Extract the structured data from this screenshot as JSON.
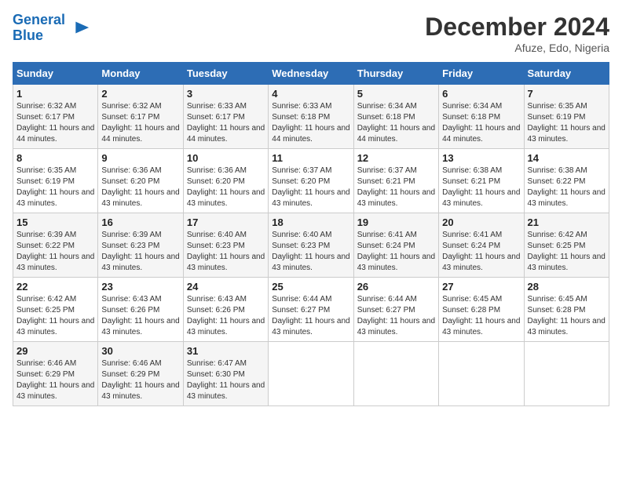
{
  "logo": {
    "line1": "General",
    "line2": "Blue"
  },
  "title": {
    "month": "December 2024",
    "location": "Afuze, Edo, Nigeria"
  },
  "days_of_week": [
    "Sunday",
    "Monday",
    "Tuesday",
    "Wednesday",
    "Thursday",
    "Friday",
    "Saturday"
  ],
  "weeks": [
    [
      {
        "day": "1",
        "sunrise": "6:32 AM",
        "sunset": "6:17 PM",
        "daylight": "11 hours and 44 minutes."
      },
      {
        "day": "2",
        "sunrise": "6:32 AM",
        "sunset": "6:17 PM",
        "daylight": "11 hours and 44 minutes."
      },
      {
        "day": "3",
        "sunrise": "6:33 AM",
        "sunset": "6:17 PM",
        "daylight": "11 hours and 44 minutes."
      },
      {
        "day": "4",
        "sunrise": "6:33 AM",
        "sunset": "6:18 PM",
        "daylight": "11 hours and 44 minutes."
      },
      {
        "day": "5",
        "sunrise": "6:34 AM",
        "sunset": "6:18 PM",
        "daylight": "11 hours and 44 minutes."
      },
      {
        "day": "6",
        "sunrise": "6:34 AM",
        "sunset": "6:18 PM",
        "daylight": "11 hours and 44 minutes."
      },
      {
        "day": "7",
        "sunrise": "6:35 AM",
        "sunset": "6:19 PM",
        "daylight": "11 hours and 43 minutes."
      }
    ],
    [
      {
        "day": "8",
        "sunrise": "6:35 AM",
        "sunset": "6:19 PM",
        "daylight": "11 hours and 43 minutes."
      },
      {
        "day": "9",
        "sunrise": "6:36 AM",
        "sunset": "6:20 PM",
        "daylight": "11 hours and 43 minutes."
      },
      {
        "day": "10",
        "sunrise": "6:36 AM",
        "sunset": "6:20 PM",
        "daylight": "11 hours and 43 minutes."
      },
      {
        "day": "11",
        "sunrise": "6:37 AM",
        "sunset": "6:20 PM",
        "daylight": "11 hours and 43 minutes."
      },
      {
        "day": "12",
        "sunrise": "6:37 AM",
        "sunset": "6:21 PM",
        "daylight": "11 hours and 43 minutes."
      },
      {
        "day": "13",
        "sunrise": "6:38 AM",
        "sunset": "6:21 PM",
        "daylight": "11 hours and 43 minutes."
      },
      {
        "day": "14",
        "sunrise": "6:38 AM",
        "sunset": "6:22 PM",
        "daylight": "11 hours and 43 minutes."
      }
    ],
    [
      {
        "day": "15",
        "sunrise": "6:39 AM",
        "sunset": "6:22 PM",
        "daylight": "11 hours and 43 minutes."
      },
      {
        "day": "16",
        "sunrise": "6:39 AM",
        "sunset": "6:23 PM",
        "daylight": "11 hours and 43 minutes."
      },
      {
        "day": "17",
        "sunrise": "6:40 AM",
        "sunset": "6:23 PM",
        "daylight": "11 hours and 43 minutes."
      },
      {
        "day": "18",
        "sunrise": "6:40 AM",
        "sunset": "6:23 PM",
        "daylight": "11 hours and 43 minutes."
      },
      {
        "day": "19",
        "sunrise": "6:41 AM",
        "sunset": "6:24 PM",
        "daylight": "11 hours and 43 minutes."
      },
      {
        "day": "20",
        "sunrise": "6:41 AM",
        "sunset": "6:24 PM",
        "daylight": "11 hours and 43 minutes."
      },
      {
        "day": "21",
        "sunrise": "6:42 AM",
        "sunset": "6:25 PM",
        "daylight": "11 hours and 43 minutes."
      }
    ],
    [
      {
        "day": "22",
        "sunrise": "6:42 AM",
        "sunset": "6:25 PM",
        "daylight": "11 hours and 43 minutes."
      },
      {
        "day": "23",
        "sunrise": "6:43 AM",
        "sunset": "6:26 PM",
        "daylight": "11 hours and 43 minutes."
      },
      {
        "day": "24",
        "sunrise": "6:43 AM",
        "sunset": "6:26 PM",
        "daylight": "11 hours and 43 minutes."
      },
      {
        "day": "25",
        "sunrise": "6:44 AM",
        "sunset": "6:27 PM",
        "daylight": "11 hours and 43 minutes."
      },
      {
        "day": "26",
        "sunrise": "6:44 AM",
        "sunset": "6:27 PM",
        "daylight": "11 hours and 43 minutes."
      },
      {
        "day": "27",
        "sunrise": "6:45 AM",
        "sunset": "6:28 PM",
        "daylight": "11 hours and 43 minutes."
      },
      {
        "day": "28",
        "sunrise": "6:45 AM",
        "sunset": "6:28 PM",
        "daylight": "11 hours and 43 minutes."
      }
    ],
    [
      {
        "day": "29",
        "sunrise": "6:46 AM",
        "sunset": "6:29 PM",
        "daylight": "11 hours and 43 minutes."
      },
      {
        "day": "30",
        "sunrise": "6:46 AM",
        "sunset": "6:29 PM",
        "daylight": "11 hours and 43 minutes."
      },
      {
        "day": "31",
        "sunrise": "6:47 AM",
        "sunset": "6:30 PM",
        "daylight": "11 hours and 43 minutes."
      },
      null,
      null,
      null,
      null
    ]
  ],
  "labels": {
    "sunrise": "Sunrise:",
    "sunset": "Sunset:",
    "daylight": "Daylight:"
  }
}
